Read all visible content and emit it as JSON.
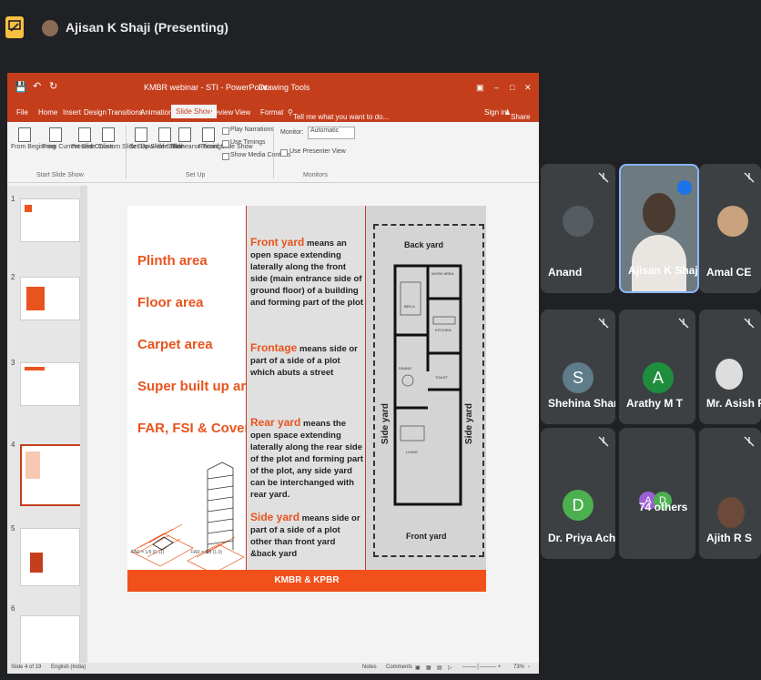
{
  "meeting": {
    "presenter_label": "Ajisan K Shaji (Presenting)"
  },
  "powerpoint": {
    "file_title": "KMBR webinar - STI - PowerPoint",
    "drawing_tools": "Drawing Tools",
    "tabs": [
      "File",
      "Home",
      "Insert",
      "Design",
      "Transitions",
      "Animations",
      "Slide Show",
      "Review",
      "View",
      "Format"
    ],
    "tell_me": "Tell me what you want to do...",
    "sign_in": "Sign in",
    "share": "Share",
    "ribbon": {
      "from_beginning": "From Beginning",
      "from_current": "From Current Slide",
      "present_online": "Present Online",
      "custom_show": "Custom Slide Show",
      "set_up": "Set Up Slide Show",
      "hide_slide": "Hide Slide",
      "rehearse": "Rehearse Timings",
      "record": "Record Slide Show",
      "play_narrations": "Play Narrations",
      "use_timings": "Use Timings",
      "show_media": "Show Media Controls",
      "monitor": "Monitor:",
      "monitor_value": "Automatic",
      "use_presenter": "Use Presenter View",
      "grp_start": "Start Slide Show",
      "grp_setup": "Set Up",
      "grp_monitors": "Monitors"
    },
    "status": {
      "slide_info": "Slide 4 of 19",
      "language": "English (India)",
      "notes": "Notes",
      "comments": "Comments",
      "zoom": "73%"
    },
    "thumbnail_numbers": [
      "1",
      "2",
      "3",
      "4",
      "5",
      "6"
    ]
  },
  "slide": {
    "terms": [
      "Plinth area",
      "Floor area",
      "Carpet area",
      "Super built up area",
      "FAR, FSI & Coverage"
    ],
    "far_caption_1": "FAR = 1/9 (0.11)",
    "far_caption_2": "FAR = 8/8 (1.0)",
    "definitions": [
      {
        "term": "Front yard",
        "text": " means an open space extending laterally along the front side (main entrance side of ground floor) of a building and forming part of the plot"
      },
      {
        "term": "Frontage",
        "text": " means side or part of a side of a plot which abuts a street"
      },
      {
        "term": "Rear yard",
        "text": " means the open space extending laterally along the rear side of the plot and forming part of the plot, any side yard can be interchanged with rear yard."
      },
      {
        "term": "Side yard",
        "text": " means side or part of a side of a plot other than front yard &back yard"
      }
    ],
    "plan": {
      "back_yard": "Back yard",
      "front_yard": "Front yard",
      "side_yard": "Side yard",
      "rooms": [
        "BED A",
        "WORK AREA",
        "KITCHEN",
        "DINING",
        "TOILET",
        "LIVING"
      ]
    },
    "footer": "KMBR & KPBR"
  },
  "participants": [
    {
      "name": "Anand"
    },
    {
      "name": "Ajisan K Shaji"
    },
    {
      "name": "Amal CE"
    },
    {
      "name": "Shehina Shareef",
      "initial": "S",
      "color": "#5f7c8a"
    },
    {
      "name": "Arathy M T",
      "initial": "A",
      "color": "#1e8e3e"
    },
    {
      "name": "Mr. Asish Prasad"
    },
    {
      "name": "Dr. Priya Acha...",
      "initial": "D",
      "color": "#4caf50"
    },
    {
      "name": "74 others",
      "initial_a": "A",
      "initial_d": "D"
    },
    {
      "name": "Ajith R S"
    }
  ]
}
